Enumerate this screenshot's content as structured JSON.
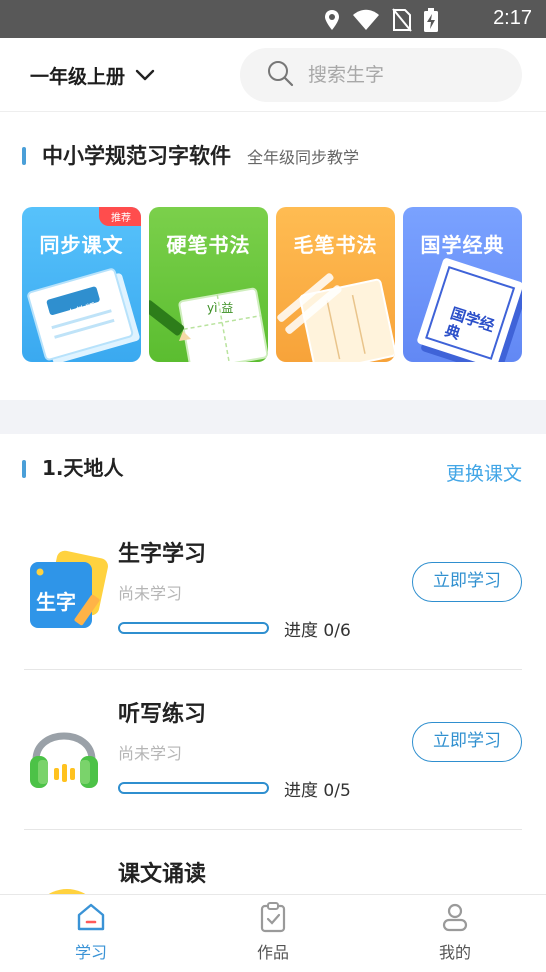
{
  "status_bar": {
    "time": "2:17",
    "icons": [
      "location-icon",
      "wifi-icon",
      "sim-off-icon",
      "battery-charging-icon"
    ]
  },
  "header": {
    "grade": "一年级上册",
    "search_placeholder": "搜索生字"
  },
  "section": {
    "title": "中小学规范习字软件",
    "subtitle": "全年级同步教学"
  },
  "cards": [
    {
      "label": "同步课文",
      "badge": "推荐",
      "sublabel": "人教版",
      "color": "#4fb9f8"
    },
    {
      "label": "硬笔书法",
      "sublabel": "yì 益",
      "color": "#6fca3f"
    },
    {
      "label": "毛笔书法",
      "sublabel": "",
      "color": "#ffb347"
    },
    {
      "label": "国学经典",
      "sublabel": "国学经典",
      "color": "#7197fb"
    }
  ],
  "lesson": {
    "title": "1.天地人",
    "change_label": "更换课文"
  },
  "items": [
    {
      "name": "生字学习",
      "icon": "character-card-icon",
      "icon_text": "生字",
      "state": "尚未学习",
      "progress_label": "进度 0/6",
      "progress": 0,
      "button": "立即学习"
    },
    {
      "name": "听写练习",
      "icon": "headphones-icon",
      "state": "尚未学习",
      "progress_label": "进度 0/5",
      "progress": 0,
      "button": "立即学习"
    },
    {
      "name": "课文诵读",
      "icon": "reading-icon"
    }
  ],
  "tabs": [
    {
      "label": "学习",
      "icon": "home-icon",
      "active": true
    },
    {
      "label": "作品",
      "icon": "clipboard-check-icon",
      "active": false
    },
    {
      "label": "我的",
      "icon": "user-icon",
      "active": false
    }
  ],
  "colors": {
    "accent": "#2f8fcf",
    "link": "#43a6e6",
    "active_tab": "#3a93d6"
  }
}
